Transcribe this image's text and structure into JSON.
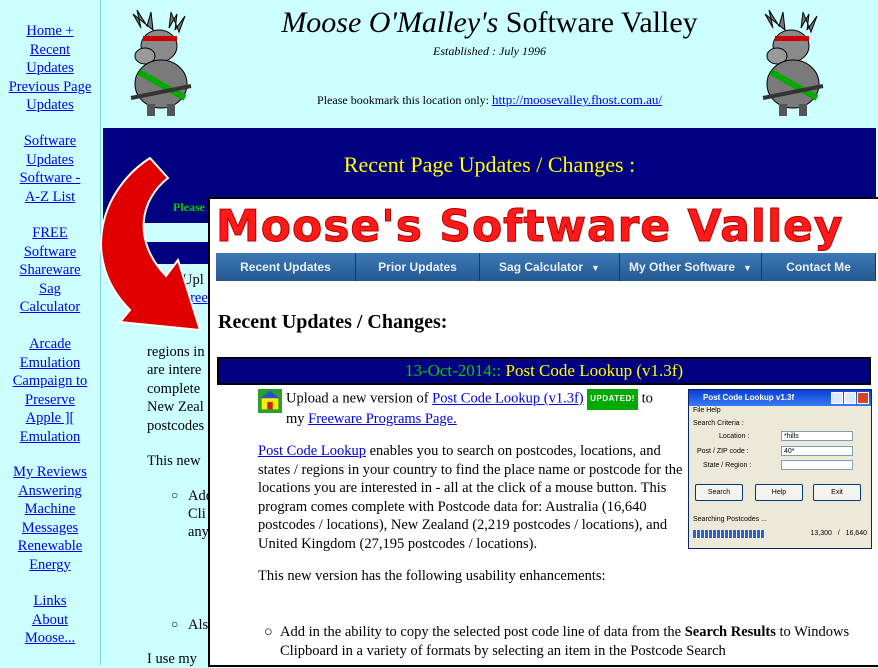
{
  "old_site": {
    "sidebar": [
      [
        "Home +",
        "Recent",
        "Updates",
        "Previous Page",
        "Updates"
      ],
      [
        "Software",
        "Updates",
        "Software -",
        "A-Z List"
      ],
      [
        "FREE",
        "Software",
        "Shareware",
        "Sag",
        "Calculator"
      ],
      [
        "Arcade",
        "Emulation",
        "Campaign to",
        "Preserve",
        "Apple ][",
        "Emulation"
      ],
      [
        "My Reviews",
        "Answering",
        "Machine",
        "Messages",
        "Renewable",
        "Energy"
      ],
      [
        "Links",
        "About",
        "Moose..."
      ]
    ],
    "title_italic": "Moose O'Malley's",
    "title_rest": " Software Valley",
    "established": "Established : July 1996",
    "bookmark_text": "Please bookmark this location only: ",
    "bookmark_url": "http://moosevalley.fhost.com.au/",
    "banner_title": "Recent Page Updates / Changes :",
    "please_text": "Please",
    "content_fragments": {
      "upl": "Upl",
      "free": "Free",
      "c": "c",
      "regions": "regions in",
      "are": "are intere",
      "complete": "complete",
      "nz": "New Zeal",
      "postcodes": "postcodes",
      "this_new": "This new",
      "add": "Add",
      "cli": "Cli",
      "any": "any",
      "als": "Als",
      "iuse": "I use my"
    }
  },
  "new_site": {
    "logo": "Moose's Software Valley",
    "nav": [
      {
        "label": "Recent Updates",
        "caret": ""
      },
      {
        "label": "Prior Updates",
        "caret": ""
      },
      {
        "label": "Sag Calculator",
        "caret": "▼"
      },
      {
        "label": "My Other Software",
        "caret": "▼"
      },
      {
        "label": "Contact Me",
        "caret": ""
      }
    ],
    "heading": "Recent Updates / Changes:",
    "banner_date": "13-Oct-2014::",
    "banner_title": " Post Code Lookup (v1.3f)",
    "upload_pre": "Upload a new version of ",
    "upload_link": "Post Code Lookup (v1.3f)",
    "updated_badge": "UPDATED!",
    "upload_to": " to",
    "upload_mid": "my ",
    "upload_page": "Freeware Programs Page.",
    "desc_link": "Post Code Lookup",
    "desc_text": " enables you to search on postcodes, locations, and states / regions in your country to find the place name or postcode for the locations you are interested in - all at the click of a mouse button. This program comes complete with Postcode data for: Australia (16,640 postcodes / locations), New Zealand (2,219 postcodes / locations), and United Kingdom (27,195 postcodes / locations).",
    "enh_text": "This new version has the following usability enhancements:",
    "bullet_pre": "Add in the ability to copy the selected post code line of data from the ",
    "bullet_bold": "Search Results",
    "bullet_post": " to Windows Clipboard in a variety of formats by selecting an item in the Postcode Search"
  },
  "app": {
    "title": "Post Code Lookup v1.3f",
    "menu": "File  Help",
    "criteria": "Search Criteria :",
    "location_label": "Location :",
    "location_value": "*hills",
    "post_label": "Post / ZIP code :",
    "post_value": "40*",
    "state_label": "State / Region :",
    "state_value": "",
    "btn_search": "Search",
    "btn_help": "Help",
    "btn_exit": "Exit",
    "status": "Searching Postcodes ...",
    "progress": 0.8,
    "count_a": "13,300",
    "count_sep": "/",
    "count_b": "16,640"
  },
  "colors": {
    "old_bg": "#ccffff",
    "banner": "#000080",
    "banner_text": "#ffff00",
    "logo": "#ff1a1a",
    "arrow": "#e00000"
  }
}
